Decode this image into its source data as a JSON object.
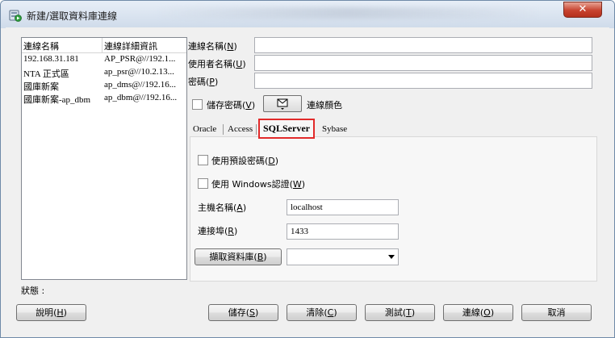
{
  "window": {
    "title": "新建/選取資料庫連線",
    "close_glyph": "✕"
  },
  "connection_list": {
    "columns": [
      "連線名稱",
      "連線詳細資訊"
    ],
    "rows": [
      {
        "name": "192.168.31.181",
        "detail": "AP_PSR@//192.1..."
      },
      {
        "name": "NTA 正式區",
        "detail": "ap_psr@//10.2.13..."
      },
      {
        "name": "國庫新案",
        "detail": "ap_dms@//192.16..."
      },
      {
        "name": "國庫新案-ap_dbm",
        "detail": "ap_dbm@//192.16..."
      }
    ]
  },
  "form": {
    "connection_name": {
      "label": "連線名稱",
      "key": "N",
      "value": ""
    },
    "username": {
      "label": "使用者名稱",
      "key": "U",
      "value": ""
    },
    "password": {
      "label": "密碼",
      "key": "P",
      "value": ""
    },
    "save_password": {
      "label": "儲存密碼",
      "key": "V",
      "checked": false
    },
    "connection_color": {
      "label": "連線顏色"
    }
  },
  "tabs": [
    {
      "label": "Oracle",
      "active": false
    },
    {
      "label": "Access",
      "active": false
    },
    {
      "label": "SQLServer",
      "active": true
    },
    {
      "label": "Sybase",
      "active": false
    }
  ],
  "sqlserver": {
    "use_default_password": {
      "label": "使用預設密碼",
      "key": "D",
      "checked": false
    },
    "use_windows_auth": {
      "label": "使用 Windows認證",
      "key": "W",
      "checked": false
    },
    "hostname": {
      "label": "主機名稱",
      "key": "A",
      "value": "localhost"
    },
    "port": {
      "label": "連接埠",
      "key": "R",
      "value": "1433"
    },
    "retrieve_db_button": {
      "label": "擷取資料庫",
      "key": "B"
    },
    "database_select": {
      "value": ""
    }
  },
  "status": {
    "label": "狀態 :"
  },
  "buttons": {
    "help": {
      "label": "說明",
      "key": "H"
    },
    "save": {
      "label": "儲存",
      "key": "S"
    },
    "clear": {
      "label": "清除",
      "key": "C"
    },
    "test": {
      "label": "測試",
      "key": "T"
    },
    "connect": {
      "label": "連線",
      "key": "O"
    },
    "cancel": {
      "label": "取消"
    }
  },
  "colors": {
    "highlight_border": "#e22a2a",
    "close_button": "#c7432f"
  }
}
